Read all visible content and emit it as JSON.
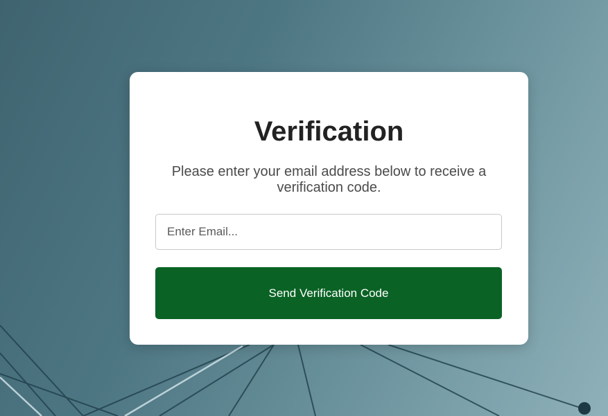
{
  "verification": {
    "title": "Verification",
    "subtitle": "Please enter your email address below to receive a verification code.",
    "email_placeholder": "Enter Email...",
    "email_value": "",
    "send_button_label": "Send Verification Code"
  },
  "colors": {
    "button": "#0a6325",
    "card": "#ffffff",
    "background": "#4d7683"
  }
}
